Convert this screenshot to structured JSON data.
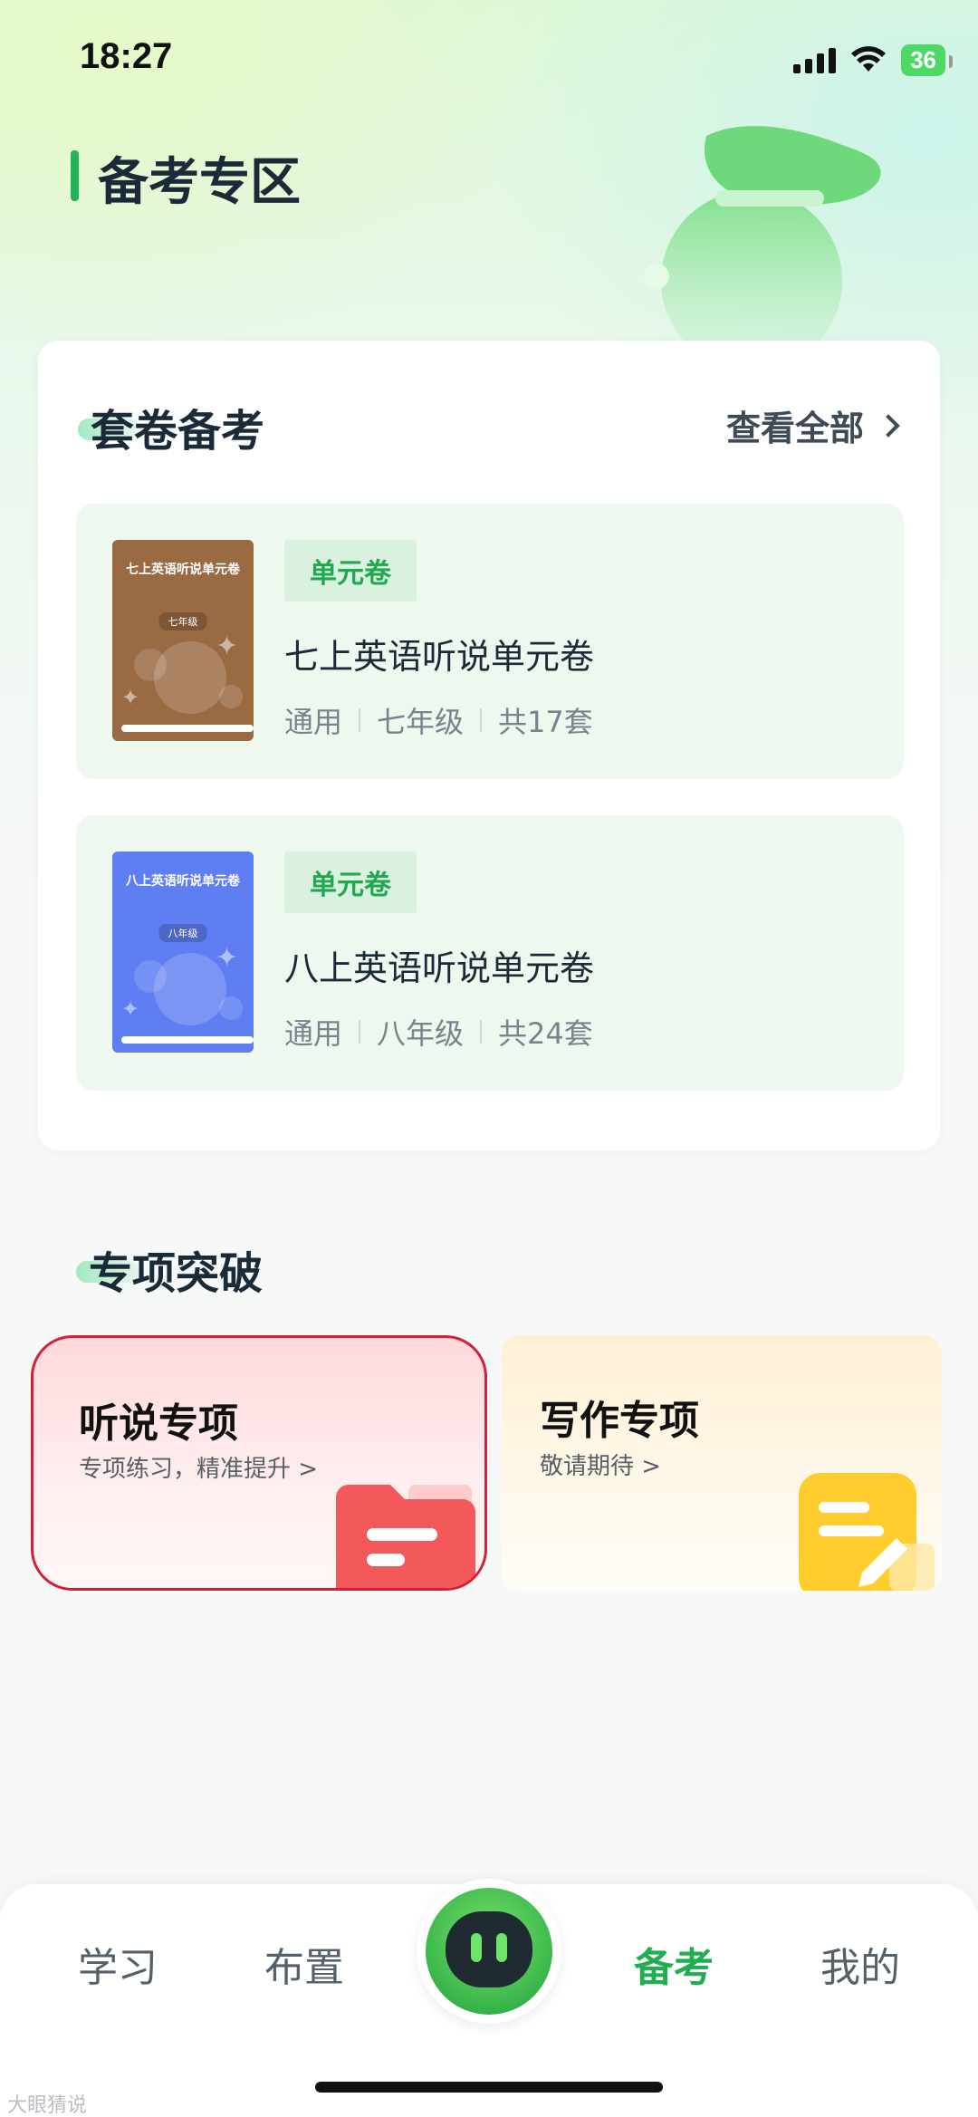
{
  "status_bar": {
    "time": "18:27",
    "battery": "36"
  },
  "page": {
    "title": "备考专区"
  },
  "exam_section": {
    "title": "套卷备考",
    "view_all_label": "查看全部",
    "items": [
      {
        "tag": "单元卷",
        "name": "七上英语听说单元卷",
        "meta": [
          "通用",
          "七年级",
          "共17套"
        ],
        "cover_title": "七上英语听说单元卷",
        "cover_grade": "七年级",
        "cover_color": "#9a6a43"
      },
      {
        "tag": "单元卷",
        "name": "八上英语听说单元卷",
        "meta": [
          "通用",
          "八年级",
          "共24套"
        ],
        "cover_title": "八上英语听说单元卷",
        "cover_grade": "八年级",
        "cover_color": "#5f7ef2"
      }
    ]
  },
  "special_section": {
    "title": "专项突破",
    "cards": [
      {
        "name": "听说专项",
        "sub": "专项练习，精准提升 >",
        "icon": "folder-icon"
      },
      {
        "name": "写作专项",
        "sub": "敬请期待 >",
        "icon": "note-edit-icon"
      }
    ]
  },
  "bottom_nav": {
    "items": [
      "学习",
      "布置",
      "备考",
      "我的"
    ],
    "active": "备考",
    "center_icon": "robot-assistant-icon"
  },
  "watermark": "大眼猜说",
  "colors": {
    "accent": "#22ad53",
    "highlight_border": "#d61f36"
  }
}
